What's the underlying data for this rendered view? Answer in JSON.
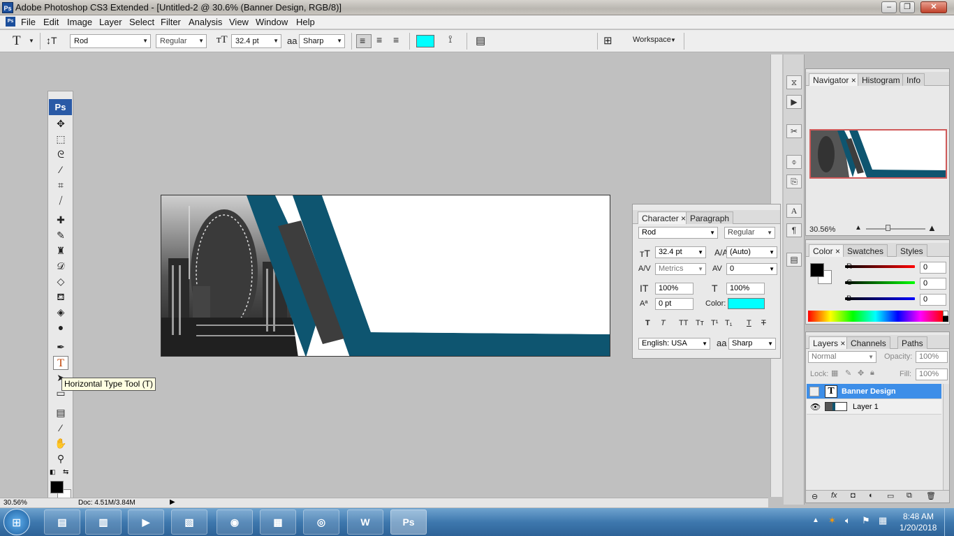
{
  "window": {
    "title": "Adobe Photoshop CS3 Extended - [Untitled-2 @ 30.6% (Banner Design, RGB/8)]",
    "app_icon": "Ps"
  },
  "menu": [
    "File",
    "Edit",
    "Image",
    "Layer",
    "Select",
    "Filter",
    "Analysis",
    "View",
    "Window",
    "Help"
  ],
  "options_bar": {
    "font_family": "Rod",
    "font_style": "Regular",
    "font_size": "32.4 pt",
    "antialias_label": "aa",
    "antialias": "Sharp",
    "color": "#00ffff",
    "workspace": "Workspace"
  },
  "toolbox": {
    "logo": "Ps",
    "tooltip": "Horizontal Type Tool (T)"
  },
  "status": {
    "zoom": "30.56%",
    "doc": "Doc: 4.51M/3.84M"
  },
  "navigator": {
    "tabs": [
      "Navigator",
      "Histogram",
      "Info"
    ],
    "zoom": "30.56%"
  },
  "character": {
    "tabs": [
      "Character",
      "Paragraph"
    ],
    "font_family": "Rod",
    "font_style": "Regular",
    "size": "32.4 pt",
    "leading": "(Auto)",
    "kerning": "Metrics",
    "tracking": "0",
    "vscale": "100%",
    "hscale": "100%",
    "baseline": "0 pt",
    "color_label": "Color:",
    "color": "#00ffff",
    "language": "English: USA",
    "aa_label": "aa",
    "antialias": "Sharp",
    "style_buttons": [
      "T",
      "T",
      "TT",
      "Tт",
      "T¹",
      "T₁",
      "T",
      "T"
    ]
  },
  "color_panel": {
    "tabs": [
      "Color",
      "Swatches",
      "Styles"
    ],
    "channels": [
      {
        "name": "R",
        "value": "0"
      },
      {
        "name": "G",
        "value": "0"
      },
      {
        "name": "B",
        "value": "0"
      }
    ]
  },
  "layers": {
    "tabs": [
      "Layers",
      "Channels",
      "Paths"
    ],
    "blend": "Normal",
    "opacity_label": "Opacity:",
    "opacity": "100%",
    "lock_label": "Lock:",
    "fill_label": "Fill:",
    "fill": "100%",
    "items": [
      {
        "name": "Banner Design",
        "thumb": "T",
        "selected": true
      },
      {
        "name": "Layer 1",
        "thumb": "",
        "selected": false
      }
    ]
  },
  "taskbar": {
    "time": "8:48 AM",
    "date": "1/20/2018",
    "apps": [
      "Ps"
    ]
  }
}
